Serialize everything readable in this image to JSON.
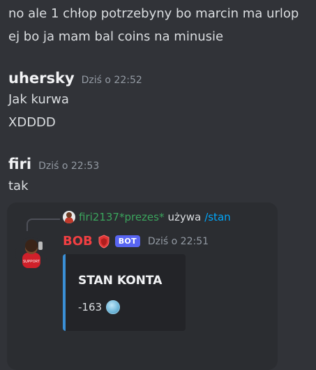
{
  "messages": {
    "line1": "no ale 1 chłop potrzebyny bo marcin ma urlop",
    "line2": "ej bo ja mam bal coins na minusie",
    "uhersky": {
      "author": "uhersky",
      "timestamp": "Dziś o 22:52",
      "lines": [
        "Jak kurwa",
        "XDDDD"
      ]
    },
    "firi": {
      "author": "firi",
      "timestamp": "Dziś o 22:53",
      "lines": [
        "tak"
      ]
    }
  },
  "bot_message": {
    "reply": {
      "user": "firi2137*prezes*",
      "text": "używa",
      "command": "/stan"
    },
    "author": "BOB",
    "tag": "BOT",
    "timestamp": "Dziś o 22:51",
    "embed": {
      "title": "STAN KONTA",
      "value": "-163",
      "accent_color": "#3a8fd6"
    }
  },
  "colors": {
    "background": "#313338",
    "bot_name": "#f23f42",
    "reply_user": "#3ba55d",
    "command": "#00a8fc",
    "bot_tag": "#5865f2"
  }
}
